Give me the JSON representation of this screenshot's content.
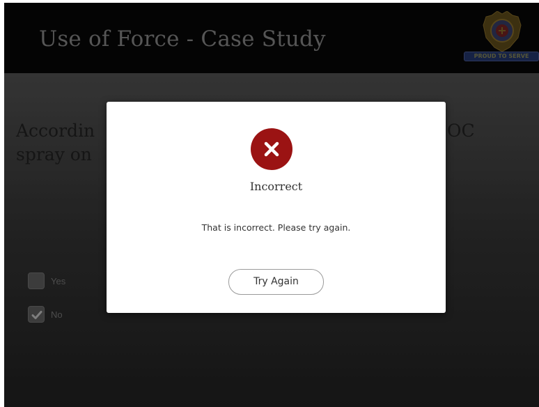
{
  "header": {
    "course_title": "Use of Force - Case Study",
    "badge": {
      "icon": "police-badge-icon",
      "ribbon_text": "PROUD TO SERVE"
    }
  },
  "question": {
    "text_visible_start": "Accordin",
    "text_visible_line2": "spray on",
    "text_visible_end": "OC"
  },
  "options": [
    {
      "label": "Yes",
      "checked": false
    },
    {
      "label": "No",
      "checked": true
    }
  ],
  "modal": {
    "icon": "error-x-icon",
    "title": "Incorrect",
    "message": "That is incorrect. Please try again.",
    "button_label": "Try Again",
    "icon_color": "#9b1313"
  }
}
